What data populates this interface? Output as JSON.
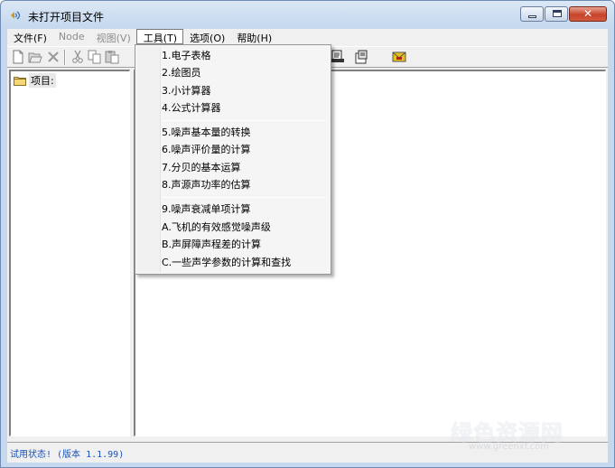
{
  "window": {
    "title": "未打开项目文件"
  },
  "menubar": [
    {
      "label": "文件(F)",
      "state": "normal"
    },
    {
      "label": "Node",
      "state": "disabled"
    },
    {
      "label": "视图(V)",
      "state": "disabled"
    },
    {
      "label": "工具(T)",
      "state": "active"
    },
    {
      "label": "选项(O)",
      "state": "normal"
    },
    {
      "label": "帮助(H)",
      "state": "normal"
    }
  ],
  "toolbar": {
    "icons": [
      "new-file-icon",
      "open-folder-icon",
      "delete-icon",
      "cut-icon",
      "copy-icon",
      "paste-icon",
      "preview-icon",
      "properties-icon",
      "envelope-icon"
    ]
  },
  "tree": {
    "root_label": "项目:"
  },
  "tools_menu": {
    "groups": [
      [
        "1.电子表格",
        "2.绘图员",
        "3.小计算器",
        "4.公式计算器"
      ],
      [
        "5.噪声基本量的转换",
        "6.噪声评价量的计算",
        "7.分贝的基本运算",
        "8.声源声功率的估算"
      ],
      [
        "9.噪声衰减单项计算",
        "A.飞机的有效感觉噪声级",
        "B.声屏障声程差的计算",
        "C.一些声学参数的计算和查找"
      ]
    ]
  },
  "statusbar": {
    "text": "试用状态! (版本 1.1.99)"
  },
  "watermark": {
    "main": "绿色资源网",
    "sub": "www.greenxf.com"
  },
  "colors": {
    "status_text": "#1a52b8",
    "close_button": "#c7432a"
  }
}
